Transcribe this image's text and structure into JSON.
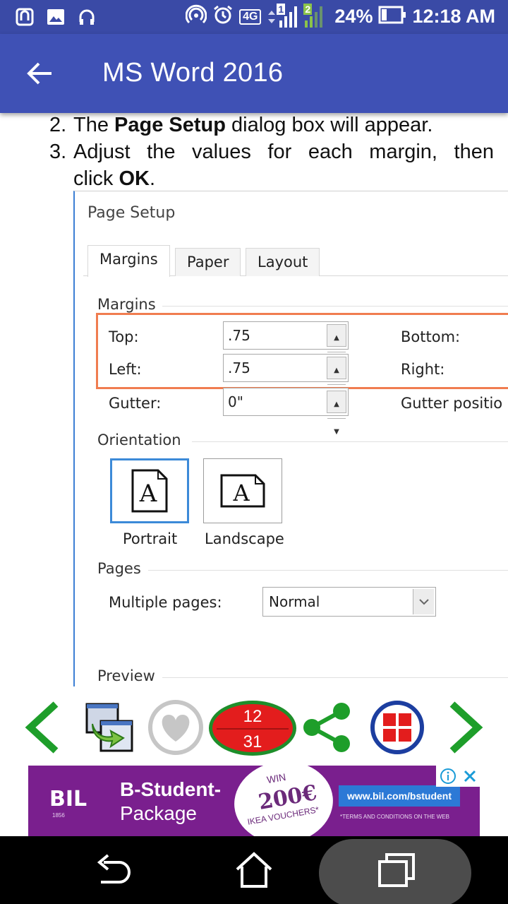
{
  "status_bar": {
    "battery": "24%",
    "time": "12:18 AM",
    "network": "4G",
    "sim1": "1",
    "sim2": "2"
  },
  "app_bar": {
    "title": "MS Word 2016"
  },
  "steps": [
    {
      "num": "2.",
      "before": "The ",
      "bold": "Page Setup",
      "after": " dialog box will appear."
    },
    {
      "num": "3.",
      "line1": "Adjust the values for each margin, then",
      "line2_before": "click ",
      "line2_bold": "OK",
      "line2_after": "."
    }
  ],
  "dialog": {
    "title": "Page Setup",
    "tabs": [
      "Margins",
      "Paper",
      "Layout"
    ],
    "margins_section": "Margins",
    "top_label": "Top:",
    "top_value": ".75",
    "bottom_label": "Bottom:",
    "left_label": "Left:",
    "left_value": ".75",
    "right_label": "Right:",
    "gutter_label": "Gutter:",
    "gutter_value": "0\"",
    "gutter_position_label": "Gutter positio",
    "orientation_section": "Orientation",
    "portrait_label": "Portrait",
    "landscape_label": "Landscape",
    "orientation_icon_letter": "A",
    "pages_section": "Pages",
    "multiple_pages_label": "Multiple pages:",
    "multiple_pages_value": "Normal",
    "preview_section": "Preview"
  },
  "toolbar": {
    "date_top": "12",
    "date_bottom": "31"
  },
  "ad": {
    "logo": "BIL",
    "logo_sub": "1856",
    "title": "B-Student-",
    "subtitle": "Package",
    "win": "WIN",
    "amount": "200€",
    "voucher": "IKEA VOUCHERS*",
    "url": "www.bil.com/bstudent",
    "terms": "*TERMS AND CONDITIONS ON THE WEB"
  },
  "colors": {
    "status_bar": "#3a4aa6",
    "app_bar": "#3f51b5",
    "green": "#1e9e2a",
    "red": "#e31d1d",
    "highlight": "#f07d50",
    "ad_purple": "#7a1f8e"
  }
}
